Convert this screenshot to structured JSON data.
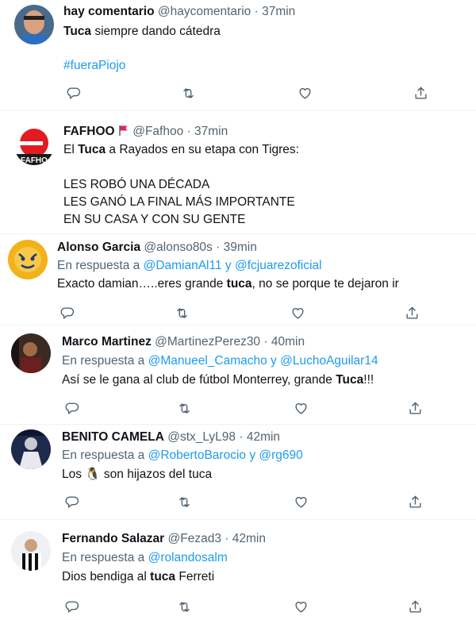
{
  "tweets": [
    {
      "name": "hay comentario",
      "handle": "@haycomentario",
      "time": "37min",
      "text_bold": "Tuca",
      "text_rest": " siempre dando cátedra",
      "hashtag": "#fueraPiojo"
    },
    {
      "name": "FAFHOO",
      "handle": "@Fafhoo",
      "time": "37min",
      "avatar_text": "FAFHO",
      "line1_pre": "El ",
      "line1_bold": "Tuca",
      "line1_post": " a Rayados en su etapa con Tigres:",
      "line2": "LES ROBÓ UNA DÉCADA",
      "line3": "LES GANÓ LA FINAL MÁS IMPORTANTE",
      "line4": "EN SU CASA Y CON SU GENTE"
    },
    {
      "name": "Alonso Garcia",
      "handle": "@alonso80s",
      "time": "39min",
      "reply_prefix": "En respuesta a ",
      "reply_to_1": "@DamianAl11",
      "reply_and": " y ",
      "reply_to_2": "@fcjuarezoficial",
      "text_pre": "Exacto damian…..eres grande ",
      "text_bold": "tuca",
      "text_post": ", no se porque te dejaron ir"
    },
    {
      "name": "Marco Martinez",
      "handle": "@MartinezPerez30",
      "time": "40min",
      "reply_prefix": "En respuesta a ",
      "reply_to_1": "@Manueel_Camacho",
      "reply_and": " y ",
      "reply_to_2": "@LuchoAguilar14",
      "text_pre": "Así se le gana al club de fútbol Monterrey, grande ",
      "text_bold": "Tuca",
      "text_post": "!!!"
    },
    {
      "name": "BENITO CAMELA",
      "handle": "@stx_LyL98",
      "time": "42min",
      "reply_prefix": "En respuesta a ",
      "reply_to_1": "@RobertoBarocio",
      "reply_and": " y ",
      "reply_to_2": "@rg690",
      "text_pre": "Los ",
      "emoji": "🐧",
      "text_post": " son hijazos del tuca"
    },
    {
      "name": "Fernando Salazar",
      "handle": "@Fezad3",
      "time": "42min",
      "reply_prefix": "En respuesta a ",
      "reply_to_1": "@rolandosalm",
      "text_pre": "Dios bendiga al ",
      "text_bold": "tuca",
      "text_post": " Ferreti"
    }
  ],
  "separator": "·",
  "icons": [
    "reply-icon",
    "retweet-icon",
    "like-icon",
    "share-icon",
    "flag-icon"
  ],
  "colors": {
    "link": "#1d9bf0",
    "muted": "#536471",
    "text": "#0f1419",
    "flag": "#e0245e"
  }
}
